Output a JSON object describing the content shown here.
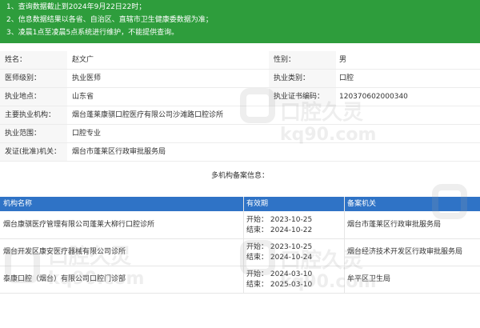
{
  "notice": [
    "1、查询数据截止到2024年9月22日22时；",
    "2、信息数据结果以各省、自治区、直辖市卫生健康委数据为准；",
    "3、凌晨1点至凌晨5点系统进行维护，不能提供查询。"
  ],
  "info": [
    {
      "l1": "姓名：",
      "v1": "赵文广",
      "l2": "性别：",
      "v2": "男"
    },
    {
      "l1": "医师级别：",
      "v1": "执业医师",
      "l2": "执业类别：",
      "v2": "口腔"
    },
    {
      "l1": "执业地点：",
      "v1": "山东省",
      "l2": "执业证书编码：",
      "v2": "120370602000340"
    },
    {
      "l1": "主要执业机构：",
      "v1": "烟台蓬莱康骐口腔医疗有限公司沙滩路口腔诊所"
    },
    {
      "l1": "执业范围：",
      "v1": "口腔专业"
    },
    {
      "l1": "发证(批准)机关：",
      "v1": "烟台市蓬莱区行政审批服务局"
    }
  ],
  "multi_title": "多机构备案信息：",
  "multi_headers": {
    "name": "机构名称",
    "validity": "有效期",
    "authority": "备案机关"
  },
  "multi_rows": [
    {
      "name": "烟台康骐医疗管理有限公司蓬莱大柳行口腔诊所",
      "start": "开始：  2023-10-25",
      "end": "结束：  2024-10-22",
      "authority": "烟台市蓬莱区行政审批服务局"
    },
    {
      "name": "烟台开发区康安医疗器械有限公司诊所",
      "start": "开始：  2023-10-25",
      "end": "结束：  2024-10-24",
      "authority": "烟台经济技术开发区行政审批服务局"
    },
    {
      "name": "泰康口腔（烟台）有限公司口腔门诊部",
      "start": "开始：  2024-03-10",
      "end": "结束：  2025-03-10",
      "authority": "牟平区卫生局"
    }
  ],
  "watermark": {
    "cn": "口腔久灵",
    "url": "kq90.com"
  },
  "colors": {
    "notice_bg": "#2e9d3c",
    "table_header_bg": "#2f73c6"
  }
}
